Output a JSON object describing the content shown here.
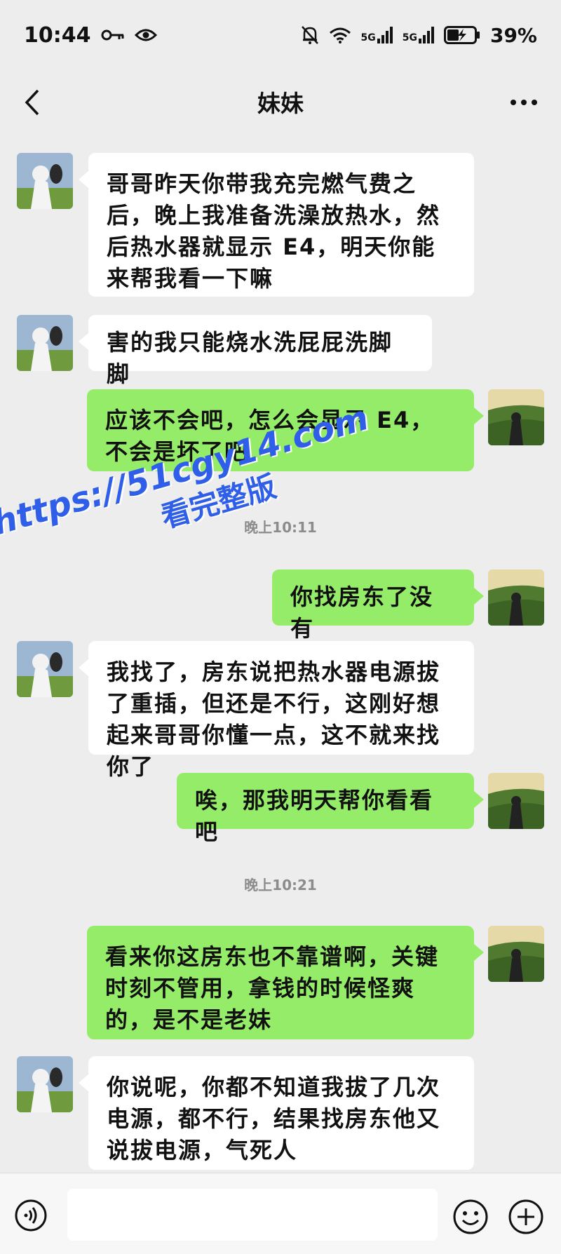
{
  "status_bar": {
    "time": "10:44",
    "network1": "5G",
    "network2": "5G",
    "battery": "39%"
  },
  "header": {
    "title": "妹妹"
  },
  "messages": [
    {
      "side": "in",
      "text": "哥哥昨天你带我充完燃气费之后，晚上我准备洗澡放热水，然后热水器就显示 E4，明天你能来帮我看一下嘛"
    },
    {
      "side": "in",
      "text": "害的我只能烧水洗屁屁洗脚脚"
    },
    {
      "side": "out",
      "text": "应该不会吧，怎么会显示 E4，不会是坏了吧"
    },
    {
      "side": "out",
      "text": "你找房东了没有"
    },
    {
      "side": "in",
      "text": "我找了，房东说把热水器电源拔了重插，但还是不行，这刚好想起来哥哥你懂一点，这不就来找你了"
    },
    {
      "side": "out",
      "text": "唉，那我明天帮你看看吧"
    },
    {
      "side": "out",
      "text": "看来你这房东也不靠谱啊，关键时刻不管用，拿钱的时候怪爽的，是不是老妹"
    },
    {
      "side": "in",
      "text": "你说呢，你都不知道我拔了几次电源，都不行，结果找房东他又说拔电源，气死人"
    }
  ],
  "timestamps": [
    "晚上10:11",
    "晚上10:21"
  ],
  "watermark": {
    "url": "https://51cgy14.com",
    "caption": "看完整版"
  },
  "colors": {
    "outgoing_bubble": "#95ec69",
    "incoming_bubble": "#ffffff",
    "background": "#ededed",
    "watermark": "#2f5fe8"
  }
}
